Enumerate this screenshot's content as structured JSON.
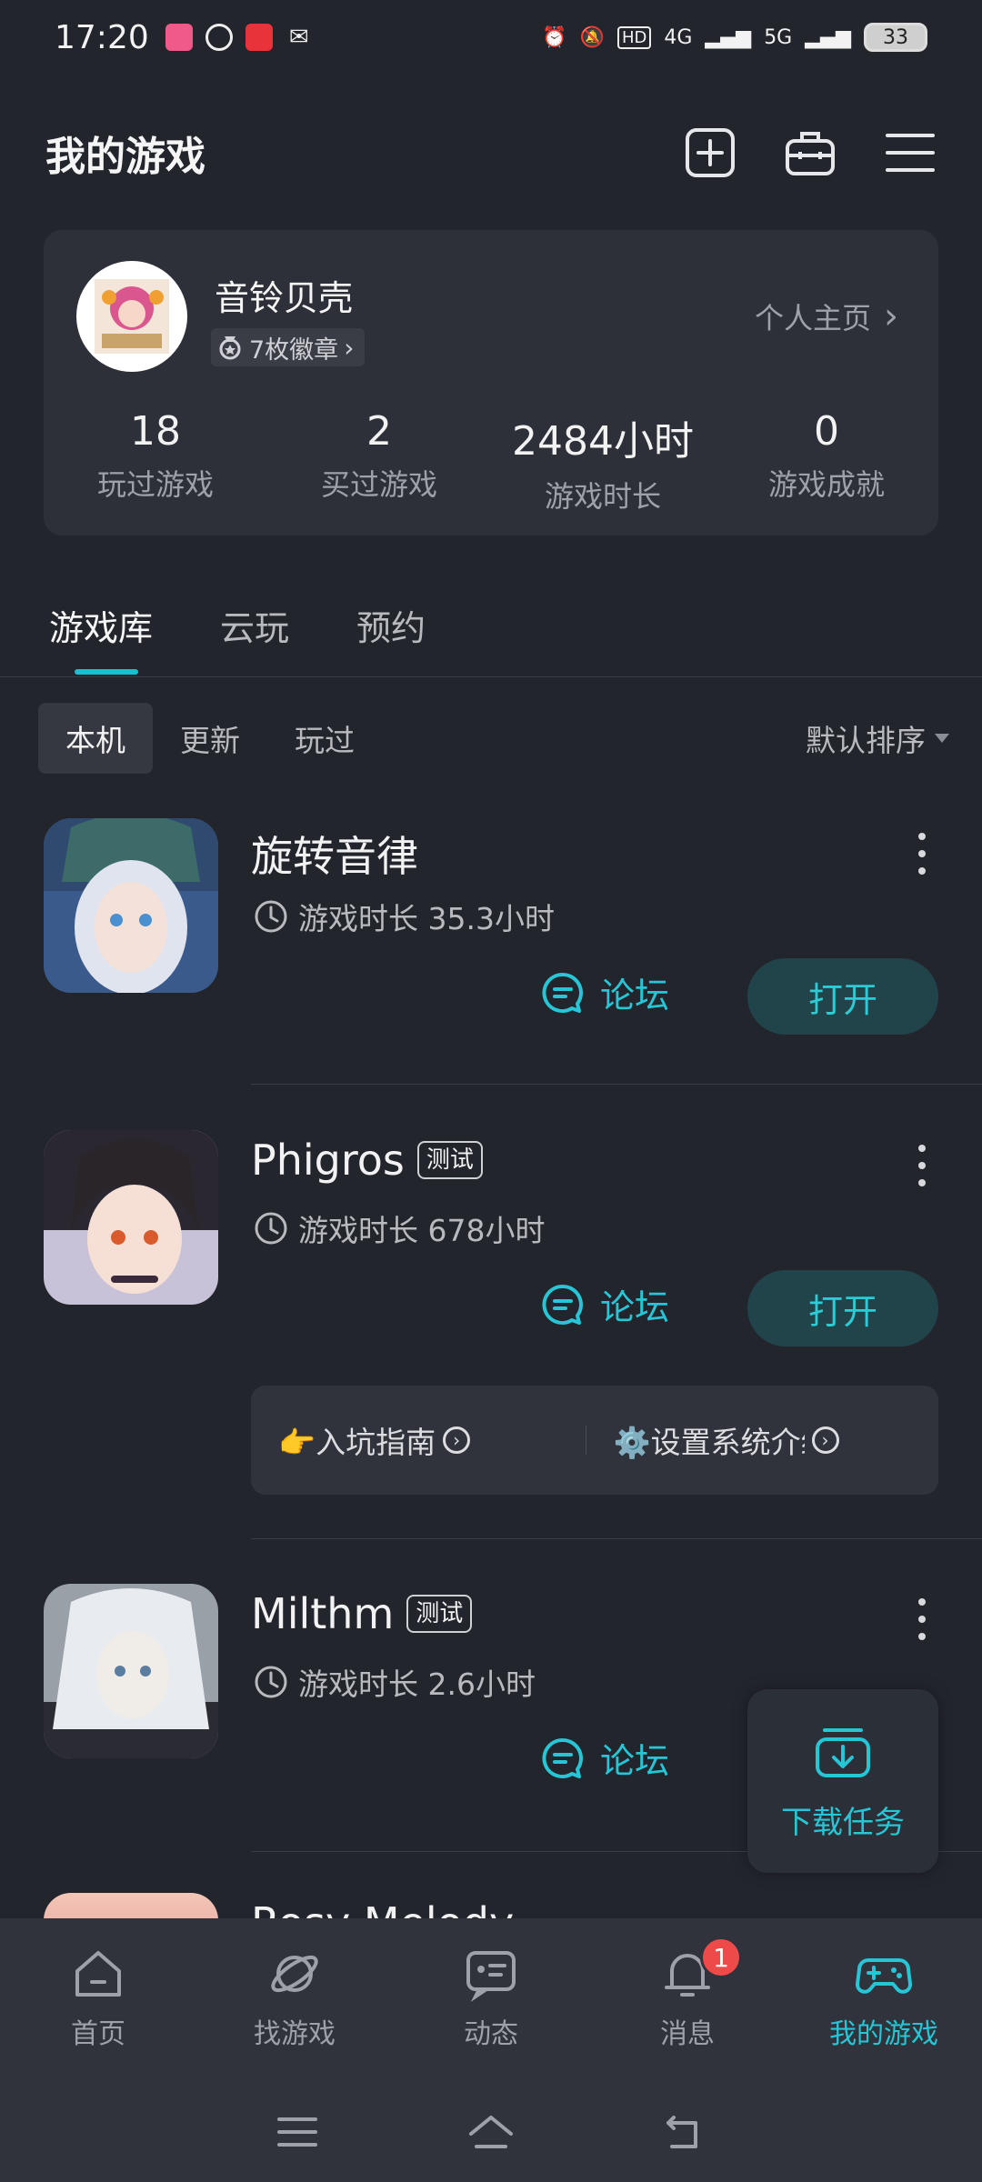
{
  "status_bar": {
    "time": "17:20",
    "network": "4G",
    "network2": "5G",
    "hd": "HD",
    "battery": "33"
  },
  "header": {
    "title": "我的游戏"
  },
  "profile": {
    "name": "音铃贝壳",
    "badges": "7枚徽章",
    "home_link": "个人主页",
    "stats": [
      {
        "value": "18",
        "label": "玩过游戏"
      },
      {
        "value": "2",
        "label": "买过游戏"
      },
      {
        "value": "2484小时",
        "label": "游戏时长"
      },
      {
        "value": "0",
        "label": "游戏成就"
      }
    ]
  },
  "main_tabs": [
    "游戏库",
    "云玩",
    "预约"
  ],
  "filters": {
    "chips": [
      "本机",
      "更新",
      "玩过"
    ],
    "sort": "默认排序"
  },
  "games": [
    {
      "name": "旋转音律",
      "test_badge": "",
      "playtime": "游戏时长 35.3小时",
      "forum": "论坛",
      "open": "打开"
    },
    {
      "name": "Phigros",
      "test_badge": "测试",
      "playtime": "游戏时长 678小时",
      "forum": "论坛",
      "open": "打开"
    },
    {
      "name": "Milthm",
      "test_badge": "测试",
      "playtime": "游戏时长 2.6小时",
      "forum": "论坛",
      "open": ""
    }
  ],
  "guide": {
    "item1": "👉入坑指南",
    "item2": "⚙️设置系统介绍"
  },
  "download": {
    "label": "下载任务"
  },
  "partial_game": {
    "name": "Rosy Melody"
  },
  "bottom_nav": {
    "items": [
      "首页",
      "找游戏",
      "动态",
      "消息",
      "我的游戏"
    ],
    "notification_count": "1",
    "accent": "#26c6d6"
  }
}
